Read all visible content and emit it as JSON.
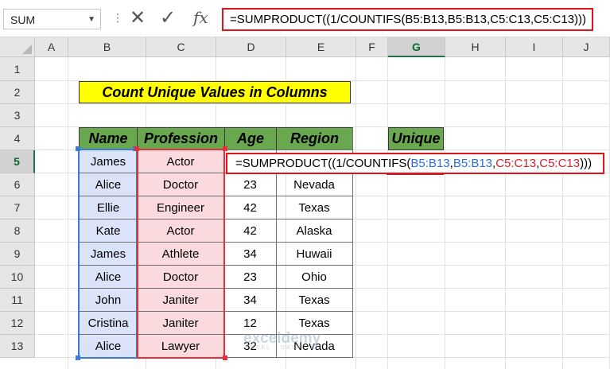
{
  "formula_bar": {
    "name_box": "SUM",
    "formula": "=SUMPRODUCT((1/COUNTIFS(B5:B13,B5:B13,C5:C13,C5:C13)))"
  },
  "columns": [
    "A",
    "B",
    "C",
    "D",
    "E",
    "F",
    "G",
    "H",
    "I",
    "J"
  ],
  "selected_column": "G",
  "rows": [
    "1",
    "2",
    "3",
    "4",
    "5",
    "6",
    "7",
    "8",
    "9",
    "10",
    "11",
    "12",
    "13"
  ],
  "selected_row": "5",
  "title": "Count Unique Values in Columns",
  "table": {
    "headers": [
      "Name",
      "Profession",
      "Age",
      "Region"
    ],
    "rows": [
      {
        "name": "James",
        "profession": "Actor",
        "age": "",
        "region": ""
      },
      {
        "name": "Alice",
        "profession": "Doctor",
        "age": "23",
        "region": "Nevada"
      },
      {
        "name": "Ellie",
        "profession": "Engineer",
        "age": "42",
        "region": "Texas"
      },
      {
        "name": "Kate",
        "profession": "Actor",
        "age": "42",
        "region": "Alaska"
      },
      {
        "name": "James",
        "profession": "Athlete",
        "age": "34",
        "region": "Huwaii"
      },
      {
        "name": "Alice",
        "profession": "Doctor",
        "age": "23",
        "region": "Ohio"
      },
      {
        "name": "John",
        "profession": "Janiter",
        "age": "34",
        "region": "Texas"
      },
      {
        "name": "Cristina",
        "profession": "Janiter",
        "age": "12",
        "region": "Texas"
      },
      {
        "name": "Alice",
        "profession": "Lawyer",
        "age": "32",
        "region": "Nevada"
      }
    ]
  },
  "unique_header": "Unique",
  "cell_formula": {
    "prefix": "=SUMPRODUCT((1/COUNTIFS(",
    "ref1": "B5:B13",
    "sep1": ",",
    "ref2": "B5:B13",
    "sep2": ",",
    "ref3": "C5:C13",
    "sep3": ",",
    "ref4": "C5:C13",
    "suffix": ")))"
  },
  "watermark": {
    "main": "exceldemy",
    "sub": "EXCEL · DATA · BI"
  }
}
